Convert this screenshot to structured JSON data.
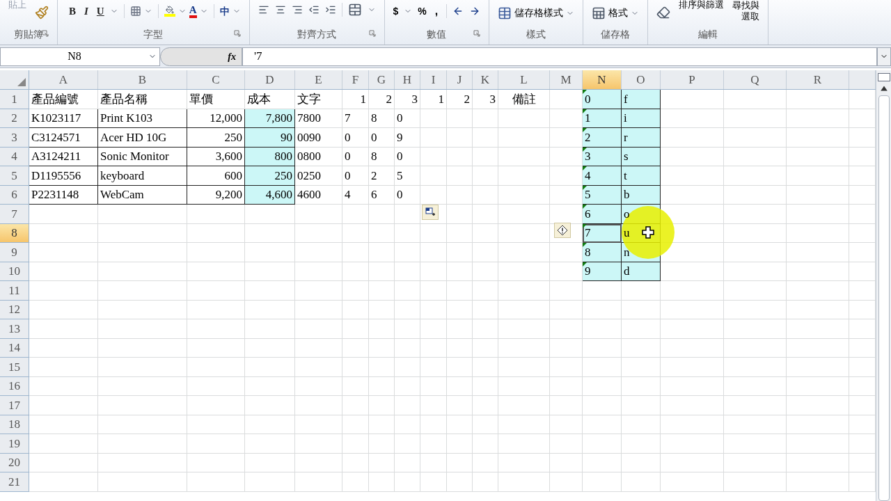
{
  "ribbon": {
    "groups": [
      {
        "kind": "clipboard",
        "label": "剪貼簿",
        "paste": "貼上",
        "launcher": true
      },
      {
        "kind": "font",
        "label": "字型",
        "bold": "B",
        "italic": "I",
        "underline": "U",
        "font_color": "A",
        "phonetic": "中",
        "launcher": true
      },
      {
        "kind": "alignment",
        "label": "對齊方式",
        "launcher": true
      },
      {
        "kind": "number",
        "label": "數值",
        "currency": "$",
        "percent": "%",
        "comma": ",",
        "launcher": true
      },
      {
        "kind": "styles",
        "label": "樣式",
        "button": "儲存格樣式"
      },
      {
        "kind": "cells",
        "label": "儲存格",
        "button": "格式"
      },
      {
        "kind": "editing",
        "label": "編輯",
        "sort": "排序與篩選",
        "find": "尋找與",
        "select": "選取"
      }
    ]
  },
  "formula_bar": {
    "name_box": "N8",
    "function_label": "fx",
    "formula": "'7"
  },
  "columns": [
    {
      "label": "A",
      "selected": false
    },
    {
      "label": "B",
      "selected": false
    },
    {
      "label": "C",
      "selected": false
    },
    {
      "label": "D",
      "selected": false
    },
    {
      "label": "E",
      "selected": false
    },
    {
      "label": "F",
      "selected": false
    },
    {
      "label": "G",
      "selected": false
    },
    {
      "label": "H",
      "selected": false
    },
    {
      "label": "I",
      "selected": false
    },
    {
      "label": "J",
      "selected": false
    },
    {
      "label": "K",
      "selected": false
    },
    {
      "label": "L",
      "selected": false
    },
    {
      "label": "M",
      "selected": false
    },
    {
      "label": "N",
      "selected": true
    },
    {
      "label": "O",
      "selected": false
    },
    {
      "label": "P",
      "selected": false
    },
    {
      "label": "Q",
      "selected": false
    },
    {
      "label": "R",
      "selected": false
    }
  ],
  "rows": [
    {
      "label": "1",
      "selected": false,
      "cells": {
        "A": {
          "text": "產品編號",
          "kind": "text"
        },
        "B": {
          "text": "產品名稱",
          "kind": "text"
        },
        "C": {
          "text": "單價",
          "kind": "text"
        },
        "D": {
          "text": "成本",
          "kind": "text"
        },
        "E": {
          "text": "文字",
          "kind": "text"
        },
        "F": {
          "text": "1",
          "kind": "number"
        },
        "G": {
          "text": "2",
          "kind": "number"
        },
        "H": {
          "text": "3",
          "kind": "number"
        },
        "I": {
          "text": "1",
          "kind": "number"
        },
        "J": {
          "text": "2",
          "kind": "number"
        },
        "K": {
          "text": "3",
          "kind": "number"
        },
        "L": {
          "text": "備註",
          "kind": "center"
        },
        "N": {
          "text": "0",
          "kind": "text",
          "highlighted": true,
          "bordered": true,
          "flagged": true
        },
        "O": {
          "text": "f",
          "kind": "text",
          "highlighted": true,
          "bordered": true
        }
      }
    },
    {
      "label": "2",
      "selected": false,
      "cells": {
        "A": {
          "text": "K1023117",
          "kind": "text",
          "bordered": true
        },
        "B": {
          "text": "Print K103",
          "kind": "text",
          "bordered": true
        },
        "C": {
          "text": "12,000",
          "kind": "number",
          "bordered": true
        },
        "D": {
          "text": "7,800",
          "kind": "number",
          "highlighted": true,
          "bordered": true
        },
        "E": {
          "text": "7800",
          "kind": "text"
        },
        "F": {
          "text": "7",
          "kind": "text"
        },
        "G": {
          "text": "8",
          "kind": "text"
        },
        "H": {
          "text": "0",
          "kind": "text"
        },
        "N": {
          "text": "1",
          "kind": "text",
          "highlighted": true,
          "bordered": true,
          "flagged": true
        },
        "O": {
          "text": "i",
          "kind": "text",
          "highlighted": true,
          "bordered": true
        }
      }
    },
    {
      "label": "3",
      "selected": false,
      "cells": {
        "A": {
          "text": "C3124571",
          "kind": "text",
          "bordered": true
        },
        "B": {
          "text": "Acer HD 10G",
          "kind": "text",
          "bordered": true
        },
        "C": {
          "text": "250",
          "kind": "number",
          "bordered": true
        },
        "D": {
          "text": "90",
          "kind": "number",
          "highlighted": true,
          "bordered": true
        },
        "E": {
          "text": "0090",
          "kind": "text"
        },
        "F": {
          "text": "0",
          "kind": "text"
        },
        "G": {
          "text": "0",
          "kind": "text"
        },
        "H": {
          "text": "9",
          "kind": "text"
        },
        "N": {
          "text": "2",
          "kind": "text",
          "highlighted": true,
          "bordered": true,
          "flagged": true
        },
        "O": {
          "text": "r",
          "kind": "text",
          "highlighted": true,
          "bordered": true
        }
      }
    },
    {
      "label": "4",
      "selected": false,
      "cells": {
        "A": {
          "text": "A3124211",
          "kind": "text",
          "bordered": true
        },
        "B": {
          "text": "Sonic Monitor",
          "kind": "text",
          "bordered": true
        },
        "C": {
          "text": "3,600",
          "kind": "number",
          "bordered": true
        },
        "D": {
          "text": "800",
          "kind": "number",
          "highlighted": true,
          "bordered": true
        },
        "E": {
          "text": "0800",
          "kind": "text"
        },
        "F": {
          "text": "0",
          "kind": "text"
        },
        "G": {
          "text": "8",
          "kind": "text"
        },
        "H": {
          "text": "0",
          "kind": "text"
        },
        "N": {
          "text": "3",
          "kind": "text",
          "highlighted": true,
          "bordered": true,
          "flagged": true
        },
        "O": {
          "text": "s",
          "kind": "text",
          "highlighted": true,
          "bordered": true
        }
      }
    },
    {
      "label": "5",
      "selected": false,
      "cells": {
        "A": {
          "text": "D1195556",
          "kind": "text",
          "bordered": true
        },
        "B": {
          "text": "keyboard",
          "kind": "text",
          "bordered": true
        },
        "C": {
          "text": "600",
          "kind": "number",
          "bordered": true
        },
        "D": {
          "text": "250",
          "kind": "number",
          "highlighted": true,
          "bordered": true
        },
        "E": {
          "text": "0250",
          "kind": "text"
        },
        "F": {
          "text": "0",
          "kind": "text"
        },
        "G": {
          "text": "2",
          "kind": "text"
        },
        "H": {
          "text": "5",
          "kind": "text"
        },
        "N": {
          "text": "4",
          "kind": "text",
          "highlighted": true,
          "bordered": true,
          "flagged": true
        },
        "O": {
          "text": "t",
          "kind": "text",
          "highlighted": true,
          "bordered": true
        }
      }
    },
    {
      "label": "6",
      "selected": false,
      "cells": {
        "A": {
          "text": "P2231148",
          "kind": "text",
          "bordered": true
        },
        "B": {
          "text": "WebCam",
          "kind": "text",
          "bordered": true
        },
        "C": {
          "text": "9,200",
          "kind": "number",
          "bordered": true
        },
        "D": {
          "text": "4,600",
          "kind": "number",
          "highlighted": true,
          "bordered": true
        },
        "E": {
          "text": "4600",
          "kind": "text"
        },
        "F": {
          "text": "4",
          "kind": "text"
        },
        "G": {
          "text": "6",
          "kind": "text"
        },
        "H": {
          "text": "0",
          "kind": "text"
        },
        "N": {
          "text": "5",
          "kind": "text",
          "highlighted": true,
          "bordered": true,
          "flagged": true
        },
        "O": {
          "text": "b",
          "kind": "text",
          "highlighted": true,
          "bordered": true
        }
      }
    },
    {
      "label": "7",
      "selected": false,
      "cells": {
        "N": {
          "text": "6",
          "kind": "text",
          "highlighted": true,
          "bordered": true,
          "flagged": true
        },
        "O": {
          "text": "o",
          "kind": "text",
          "highlighted": true,
          "bordered": true
        }
      }
    },
    {
      "label": "8",
      "selected": true,
      "cells": {
        "N": {
          "text": "7",
          "kind": "text",
          "highlighted": true,
          "bordered": true,
          "flagged": true,
          "active": true
        },
        "O": {
          "text": "u",
          "kind": "text",
          "highlighted": true,
          "bordered": true
        }
      }
    },
    {
      "label": "9",
      "selected": false,
      "cells": {
        "N": {
          "text": "8",
          "kind": "text",
          "highlighted": true,
          "bordered": true,
          "flagged": true
        },
        "O": {
          "text": "n",
          "kind": "text",
          "highlighted": true,
          "bordered": true
        }
      }
    },
    {
      "label": "10",
      "selected": false,
      "cells": {
        "N": {
          "text": "9",
          "kind": "text",
          "highlighted": true,
          "bordered": true,
          "flagged": true
        },
        "O": {
          "text": "d",
          "kind": "text",
          "highlighted": true,
          "bordered": true
        }
      }
    },
    {
      "label": "11",
      "selected": false
    },
    {
      "label": "12",
      "selected": false
    },
    {
      "label": "13",
      "selected": false
    },
    {
      "label": "14",
      "selected": false
    },
    {
      "label": "15",
      "selected": false
    },
    {
      "label": "16",
      "selected": false
    },
    {
      "label": "17",
      "selected": false
    },
    {
      "label": "18",
      "selected": false
    },
    {
      "label": "19",
      "selected": false
    },
    {
      "label": "20",
      "selected": false
    },
    {
      "label": "21",
      "selected": false
    }
  ]
}
